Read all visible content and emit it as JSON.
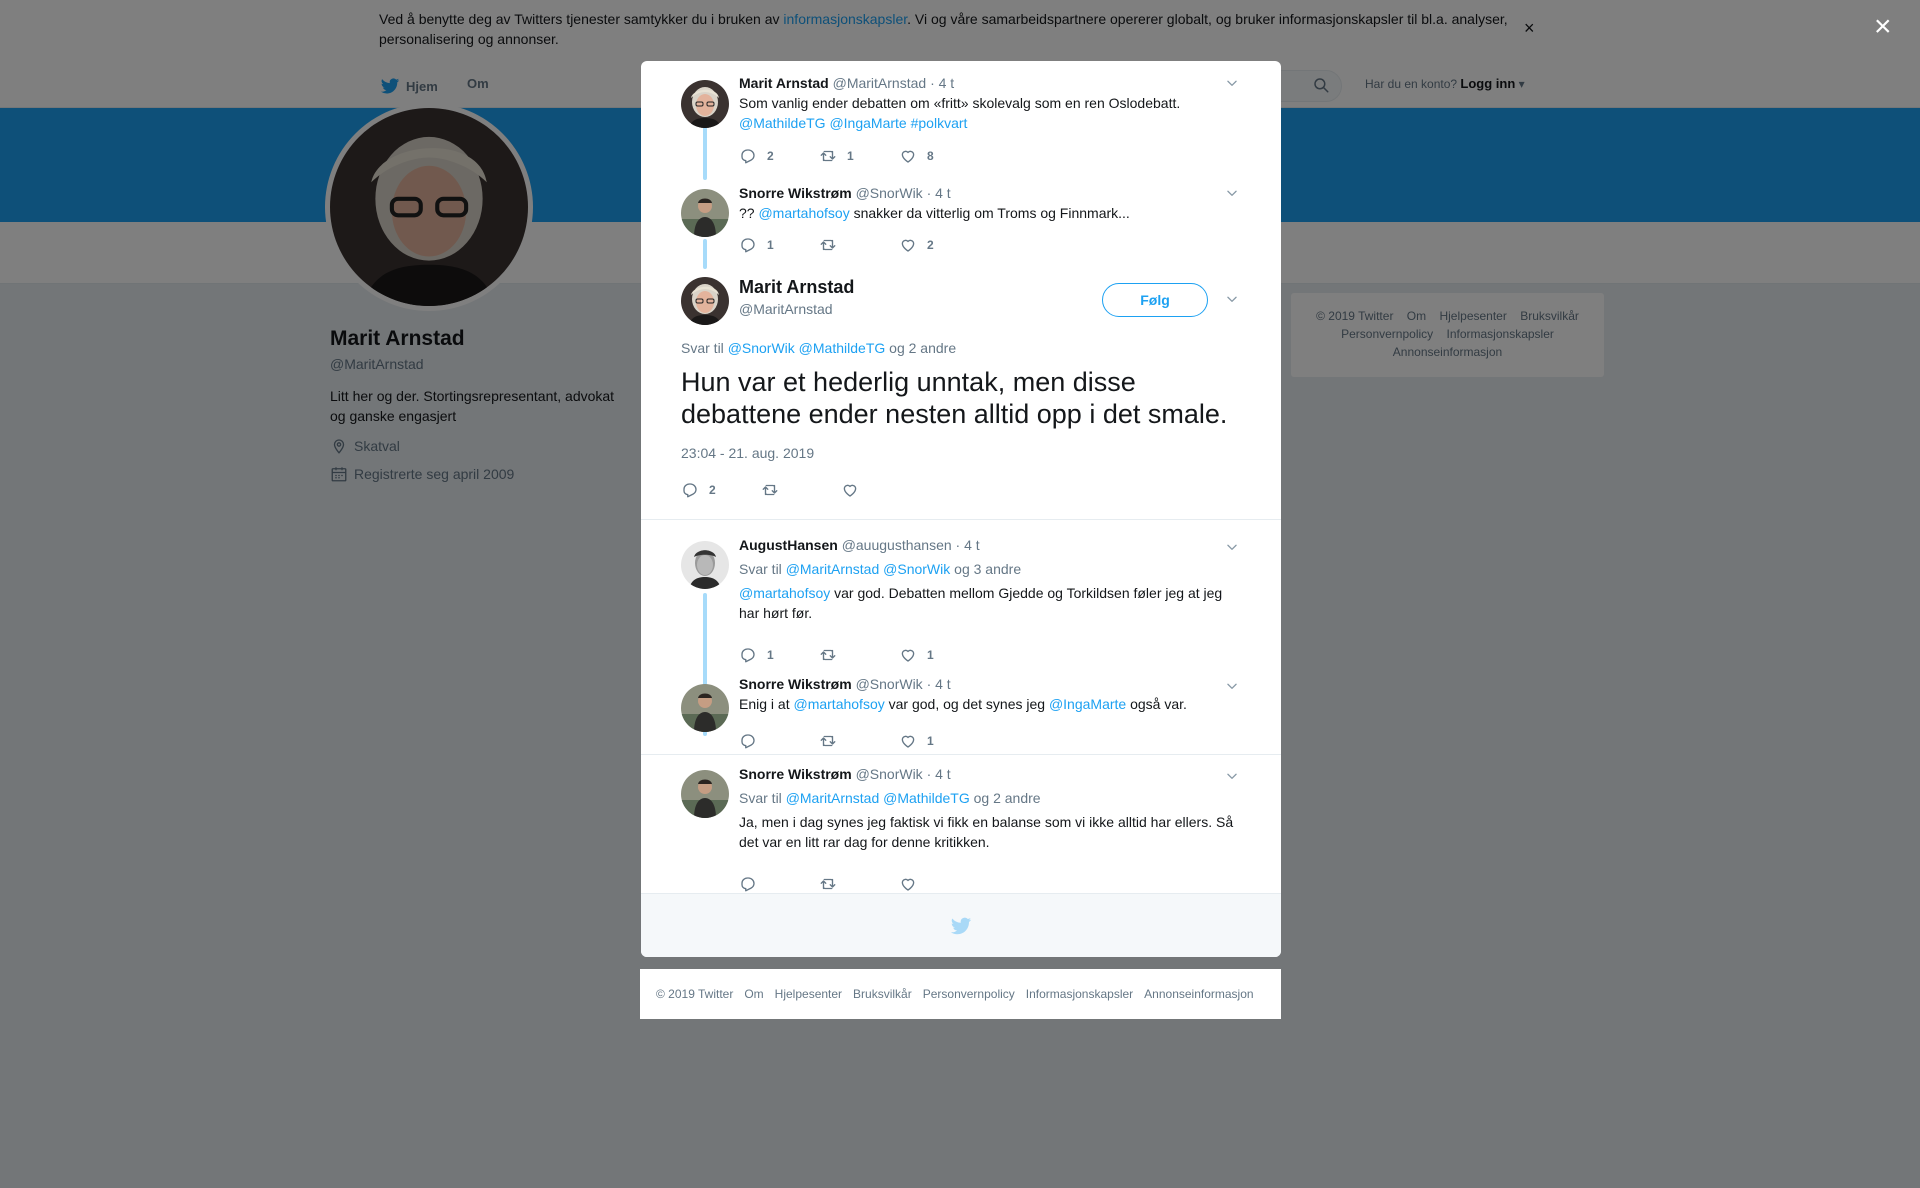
{
  "cookie_bar": {
    "text_before": "Ved å benytte deg av Twitters tjenester samtykker du i bruken av ",
    "link": "informasjonskapsler",
    "text_after": ". Vi og våre samarbeidspartnere opererer globalt, og bruker informasjonskapsler til bl.a. analyser, personalisering og annonser.",
    "close": "×"
  },
  "nav": {
    "home": "Hjem",
    "about": "Om",
    "login_prompt": "Har du en konto?",
    "login": "Logg inn"
  },
  "profile": {
    "name": "Marit Arnstad",
    "handle": "@MaritArnstad",
    "bio": "Litt her og der. Stortingsrepresentant, advokat og ganske engasjert",
    "location": "Skatval",
    "joined": "Registrerte seg april 2009"
  },
  "side_footer": [
    "© 2019 Twitter",
    "Om",
    "Hjelpesenter",
    "Bruksvilkår",
    "Personvernpolicy",
    "Informasjonskapsler",
    "Annonseinformasjon"
  ],
  "overlay_close": "×",
  "thread": [
    {
      "name": "Marit Arnstad",
      "handle": "@MaritArnstad",
      "time": "· 4 t",
      "text": "Som vanlig ender debatten om «fritt» skolevalg som en ren Oslodebatt.",
      "links": "@MathildeTG @IngaMarte #polkvart",
      "replies": "2",
      "retweets": "1",
      "likes": "8"
    },
    {
      "name": "Snorre Wikstrøm",
      "handle": "@SnorWik",
      "time": "· 4 t",
      "prefix": "?? ",
      "mention": "@martahofsoy",
      "text": " snakker da vitterlig om Troms og Finnmark...",
      "replies": "1",
      "retweets": "",
      "likes": "2"
    }
  ],
  "main_tweet": {
    "name": "Marit Arnstad",
    "handle": "@MaritArnstad",
    "follow": "Følg",
    "reply_label": "Svar til",
    "reply_mentions": "@SnorWik @MathildeTG",
    "reply_others": "og 2 andre",
    "text": "Hun var et hederlig unntak, men disse debattene ender nesten alltid opp i det smale.",
    "date": "23:04 - 21. aug. 2019",
    "replies": "2",
    "retweets": "",
    "likes": ""
  },
  "replies": [
    {
      "name": "AugustHansen",
      "handle": "@auugusthansen",
      "time": "· 4 t",
      "reply_label": "Svar til",
      "reply_mentions": "@MaritArnstad @SnorWik",
      "reply_others": "og 3 andre",
      "mention": "@martahofsoy",
      "text": " var god. Debatten mellom Gjedde og Torkildsen føler jeg at jeg har hørt før.",
      "replies": "1",
      "retweets": "",
      "likes": "1"
    },
    {
      "name": "Snorre Wikstrøm",
      "handle": "@SnorWik",
      "time": "· 4 t",
      "text_a": "Enig i at ",
      "mention_a": "@martahofsoy",
      "text_b": " var god, og det synes jeg ",
      "mention_b": "@IngaMarte",
      "text_c": " også var.",
      "replies": "",
      "retweets": "",
      "likes": "1"
    },
    {
      "name": "Snorre Wikstrøm",
      "handle": "@SnorWik",
      "time": "· 4 t",
      "reply_label": "Svar til",
      "reply_mentions": "@MaritArnstad @MathildeTG",
      "reply_others": "og 2 andre",
      "text": "Ja, men i dag synes jeg faktisk vi fikk en balanse som vi ikke alltid har ellers. Så det var en litt rar dag for denne kritikken.",
      "replies": "",
      "retweets": "",
      "likes": ""
    }
  ],
  "bottom_footer": [
    "© 2019 Twitter",
    "Om",
    "Hjelpesenter",
    "Bruksvilkår",
    "Personvernpolicy",
    "Informasjonskapsler",
    "Annonseinformasjon"
  ],
  "colors": {
    "accent": "#1da1f2",
    "thread_line": "#a7dbfa",
    "muted": "#657786"
  }
}
